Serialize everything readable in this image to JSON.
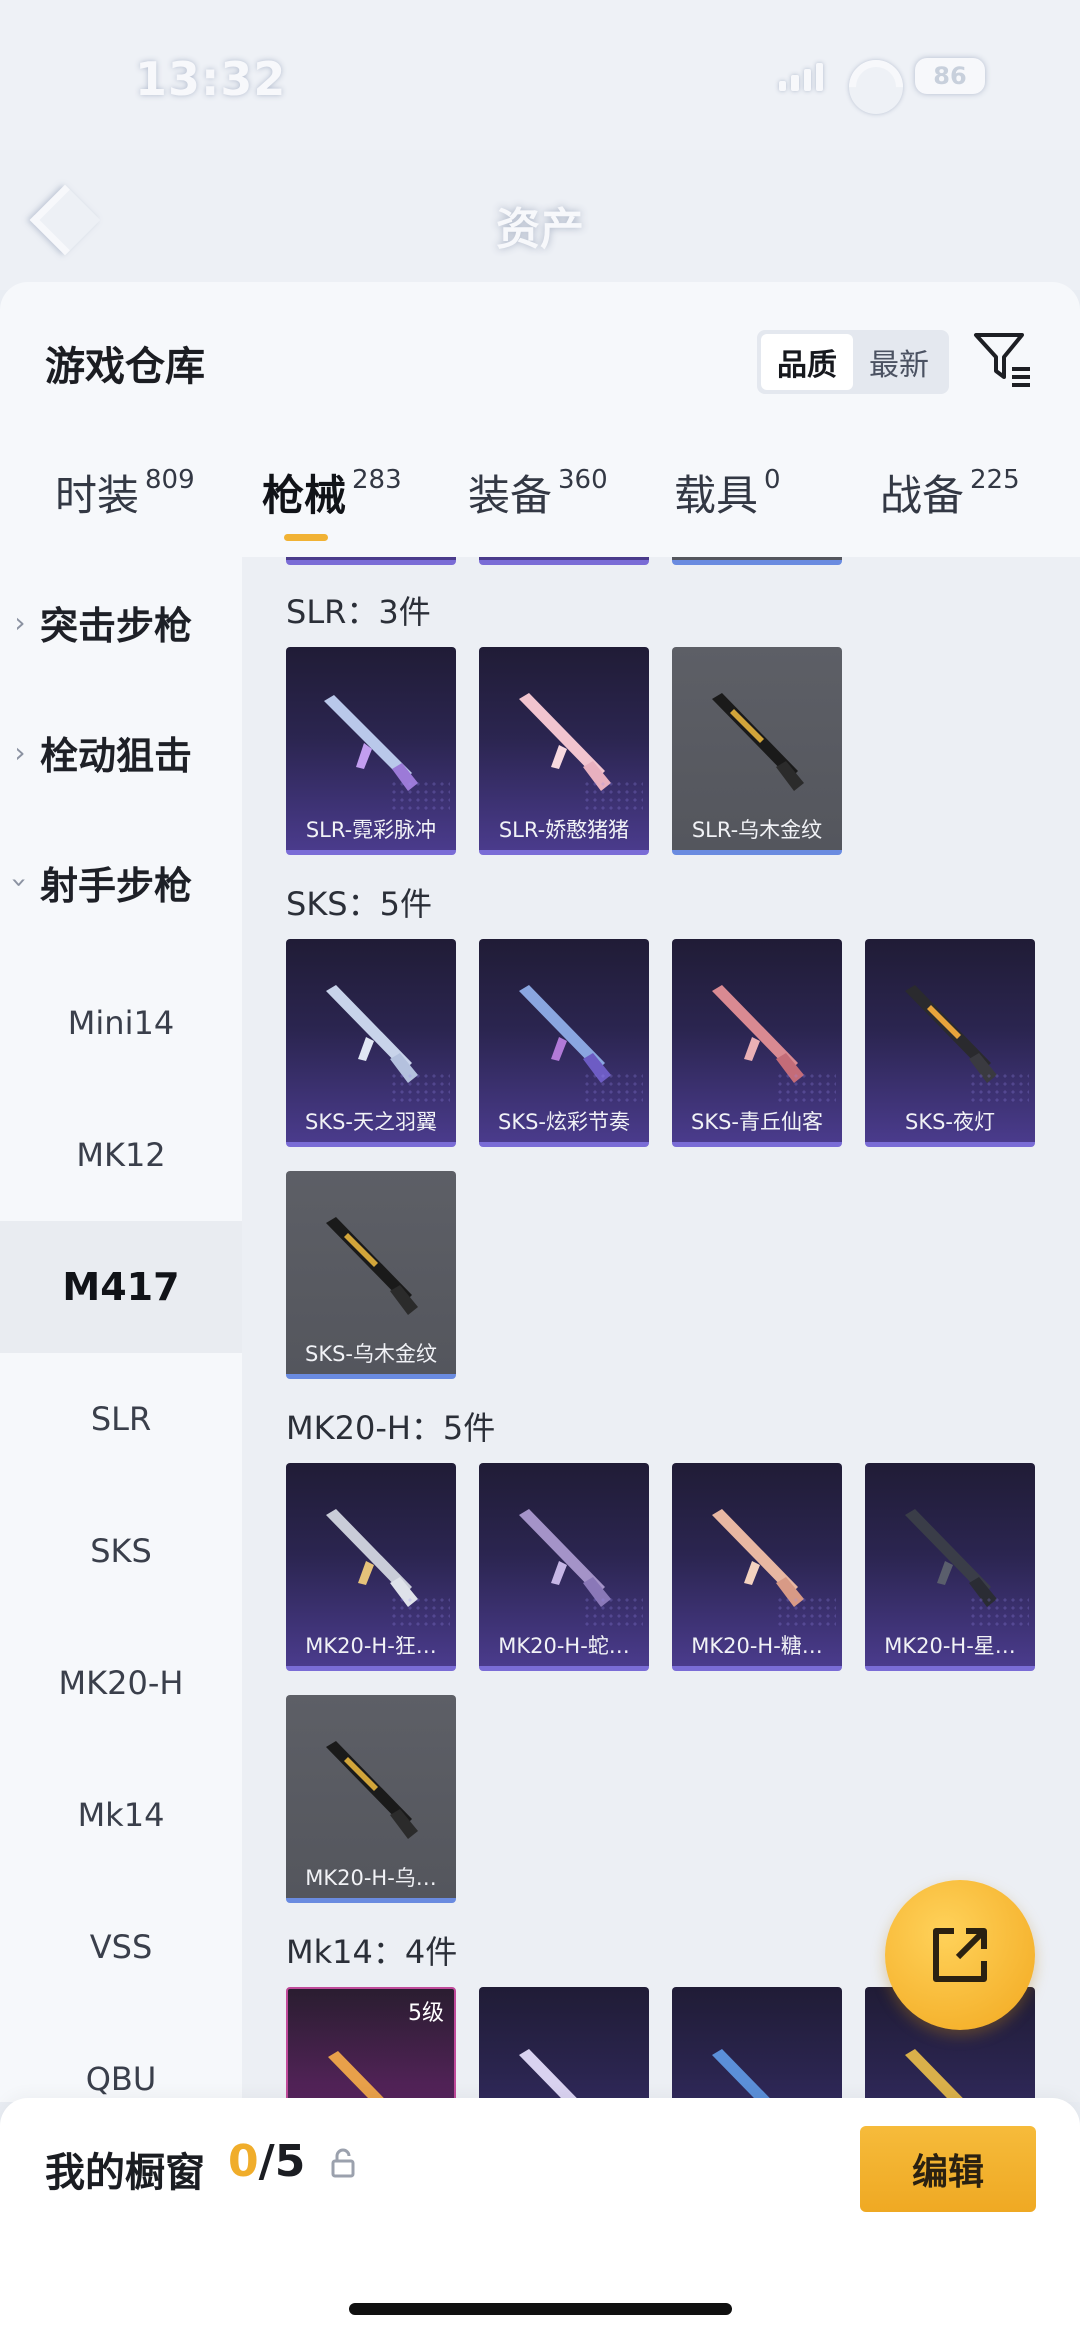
{
  "status": {
    "time": "13:32",
    "battery": "86"
  },
  "header": {
    "title": "资产"
  },
  "sheet": {
    "title": "游戏仓库",
    "sort": {
      "options": [
        "品质",
        "最新"
      ],
      "active": "品质"
    }
  },
  "tabs": [
    {
      "label": "时装",
      "count": "809"
    },
    {
      "label": "枪械",
      "count": "283"
    },
    {
      "label": "装备",
      "count": "360"
    },
    {
      "label": "载具",
      "count": "0"
    },
    {
      "label": "战备",
      "count": "225"
    }
  ],
  "sidebar": {
    "groups": [
      "突击步枪",
      "栓动狙击",
      "射手步枪"
    ],
    "items": [
      "Mini14",
      "MK12",
      "M417",
      "SLR",
      "SKS",
      "MK20-H",
      "Mk14",
      "VSS",
      "QBU"
    ],
    "active": "M417"
  },
  "sections": [
    {
      "title": "SLR：3件",
      "items": [
        "SLR-霓彩脉冲",
        "SLR-娇憨猪猪",
        "SLR-乌木金纹"
      ]
    },
    {
      "title": "SKS：5件",
      "items": [
        "SKS-天之羽翼",
        "SKS-炫彩节奏",
        "SKS-青丘仙客",
        "SKS-夜灯",
        "SKS-乌木金纹"
      ]
    },
    {
      "title": "MK20-H：5件",
      "items": [
        "MK20-H-狂…",
        "MK20-H-蛇…",
        "MK20-H-糖…",
        "MK20-H-星…",
        "MK20-H-乌…"
      ]
    },
    {
      "title": "Mk14：4件",
      "items": [
        "",
        "",
        "",
        ""
      ],
      "badge": "5级"
    }
  ],
  "bottom": {
    "label": "我的橱窗",
    "current": "0",
    "total": "/5",
    "edit": "编辑"
  },
  "colors": {
    "accent": "#f1b234",
    "card_purple": "#4a3b8c",
    "card_gray": "#5d5f66"
  },
  "icons": {
    "back": "chevron-left-icon",
    "filter": "filter-icon",
    "share": "share-external-icon",
    "lock": "lock-icon"
  }
}
